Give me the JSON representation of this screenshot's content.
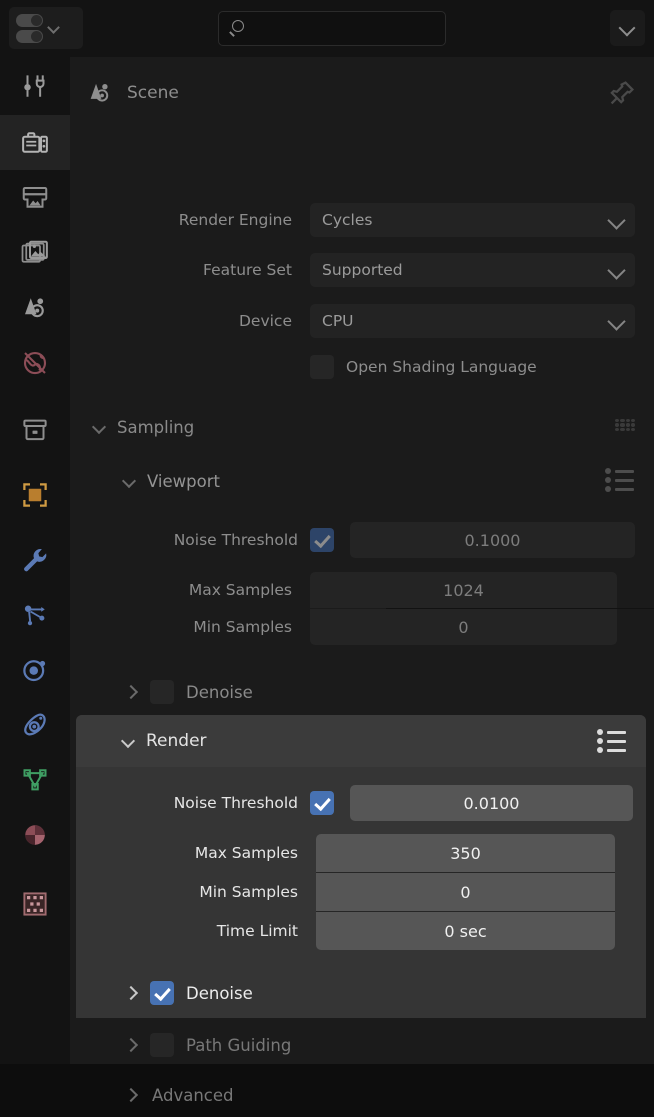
{
  "app": {
    "name": "Blender Properties Editor",
    "accent_blue": "#4772b3",
    "panel_bg": "#1b1b1b",
    "highlight_bg": "#353535"
  },
  "topbar": {
    "editor_type_label": "Editor Type",
    "search_placeholder": "",
    "search_value": "",
    "search_icon": "search-icon",
    "overflow_icon": "chevron-down-icon"
  },
  "rail": {
    "items": [
      {
        "name": "tool",
        "label": "Tool",
        "active": false
      },
      {
        "name": "render",
        "label": "Render",
        "active": true
      },
      {
        "name": "output",
        "label": "Output",
        "active": false
      },
      {
        "name": "view-layer",
        "label": "View Layer",
        "active": false
      },
      {
        "name": "scene",
        "label": "Scene",
        "active": false
      },
      {
        "name": "world",
        "label": "World",
        "active": false
      },
      {
        "name": "collection",
        "label": "Collection",
        "active": false
      },
      {
        "name": "object",
        "label": "Object",
        "active": false
      },
      {
        "name": "modifiers",
        "label": "Modifiers",
        "active": false
      },
      {
        "name": "particles",
        "label": "Particles",
        "active": false
      },
      {
        "name": "physics",
        "label": "Physics",
        "active": false
      },
      {
        "name": "constraints",
        "label": "Object Constraints",
        "active": false
      },
      {
        "name": "data",
        "label": "Object Data",
        "active": false
      },
      {
        "name": "material",
        "label": "Material",
        "active": false
      },
      {
        "name": "texture",
        "label": "Texture",
        "active": false
      }
    ]
  },
  "breadcrumb": {
    "icon": "scene-icon",
    "text": "Scene",
    "pin_icon": "pin-icon"
  },
  "properties": [
    {
      "label": "Render Engine",
      "value": "Cycles",
      "type": "dropdown"
    },
    {
      "label": "Feature Set",
      "value": "Supported",
      "type": "dropdown"
    },
    {
      "label": "Device",
      "value": "CPU",
      "type": "dropdown"
    }
  ],
  "osl": {
    "label": "Open Shading Language",
    "checked": false
  },
  "sampling": {
    "title": "Sampling",
    "expanded": true,
    "grip_icon": "grip-dots-icon",
    "viewport": {
      "title": "Viewport",
      "expanded": true,
      "preset_icon": "preset-list-icon",
      "noise_threshold": {
        "label": "Noise Threshold",
        "checked": true,
        "value": "0.1000"
      },
      "max_samples": {
        "label": "Max Samples",
        "value": "1024"
      },
      "min_samples": {
        "label": "Min Samples",
        "value": "0"
      },
      "denoise": {
        "label": "Denoise",
        "checked": false,
        "expanded": false
      }
    },
    "render": {
      "title": "Render",
      "expanded": true,
      "highlighted": true,
      "preset_icon": "preset-list-icon",
      "noise_threshold": {
        "label": "Noise Threshold",
        "checked": true,
        "value": "0.0100"
      },
      "max_samples": {
        "label": "Max Samples",
        "value": "350"
      },
      "min_samples": {
        "label": "Min Samples",
        "value": "0"
      },
      "time_limit": {
        "label": "Time Limit",
        "value": "0 sec"
      },
      "denoise": {
        "label": "Denoise",
        "checked": true,
        "expanded": false
      }
    },
    "path_guiding": {
      "label": "Path Guiding",
      "checked": false,
      "expanded": false
    },
    "advanced": {
      "label": "Advanced",
      "expanded": false
    }
  }
}
